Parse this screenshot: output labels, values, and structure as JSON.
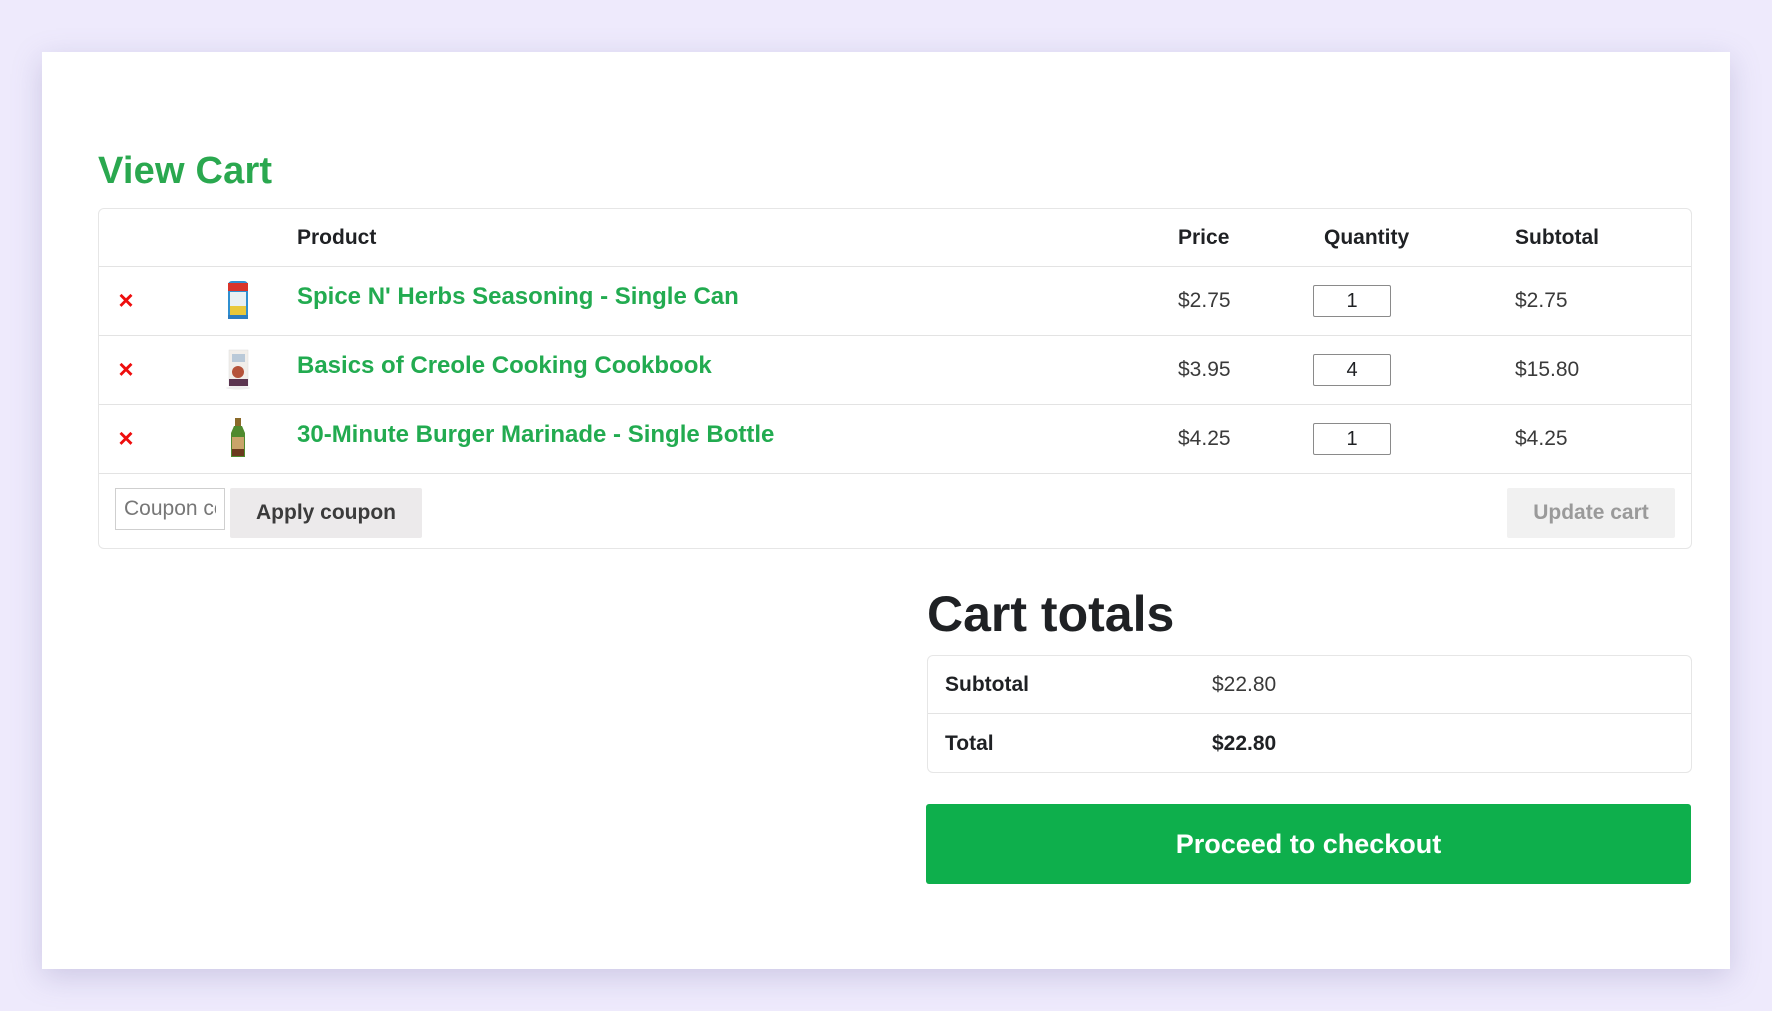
{
  "page": {
    "title": "View Cart"
  },
  "cart": {
    "headers": {
      "product": "Product",
      "price": "Price",
      "quantity": "Quantity",
      "subtotal": "Subtotal"
    },
    "remove_icon": "×",
    "items": [
      {
        "name": "Spice N' Herbs Seasoning - Single Can",
        "image": "seasoning-can",
        "price": "$2.75",
        "quantity": "1",
        "subtotal": "$2.75"
      },
      {
        "name": "Basics of Creole Cooking Cookbook",
        "image": "cookbook",
        "price": "$3.95",
        "quantity": "4",
        "subtotal": "$15.80"
      },
      {
        "name": "30-Minute Burger Marinade - Single Bottle",
        "image": "marinade-bottle",
        "price": "$4.25",
        "quantity": "1",
        "subtotal": "$4.25"
      }
    ],
    "coupon": {
      "placeholder": "Coupon code",
      "value": "",
      "apply_label": "Apply coupon"
    },
    "update_label": "Update cart"
  },
  "totals": {
    "title": "Cart totals",
    "subtotal_label": "Subtotal",
    "subtotal_value": "$22.80",
    "total_label": "Total",
    "total_value": "$22.80",
    "checkout_label": "Proceed to checkout"
  },
  "colors": {
    "accent_green": "#22ab50",
    "checkout_green": "#0eaf4c",
    "remove_red": "#ee0d0d",
    "background": "#eeeafc"
  }
}
